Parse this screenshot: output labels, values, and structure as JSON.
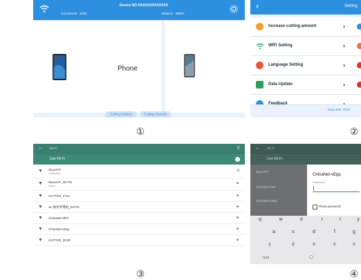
{
  "panel1": {
    "device_label": "Device NO",
    "device_no": "DXXXXXXXXXXXX",
    "cut_amount_label": "Cut amount",
    "cut_amount": "3358",
    "balance_label": "Balance",
    "balance": "89087",
    "category_label": "Phone",
    "btn_history": "Cutting history",
    "btn_favorite": "Cutting favorite"
  },
  "panel2": {
    "title": "Setting",
    "items": [
      {
        "label": "Increase cutting amount",
        "icon_color": "#f0a030",
        "dot_color": "#2d8fe0"
      },
      {
        "label": "WIFI Setting",
        "icon_color": "#2fae7c",
        "dot_color": "#f07040"
      },
      {
        "label": "Language Setting",
        "icon_color": "#e8583a",
        "dot_color": "#e03030"
      },
      {
        "label": "Data Update",
        "icon_color": "#2f9a5a",
        "dot_color": "#e03030"
      },
      {
        "label": "Feedback",
        "icon_color": "#2d8fe0",
        "dot_color": "#2d8fe0"
      }
    ],
    "data_date_label": "Data date",
    "data_date": "2023"
  },
  "panel3": {
    "title": "Wi-Fi",
    "use_wifi": "Use Wi-Fi",
    "networks": [
      {
        "name": "skycutYF",
        "status": "Connected"
      },
      {
        "name": "skycutYF_Wi-Fi5",
        "status": "Saved"
      },
      {
        "name": "CUTTER_2712",
        "status": ""
      },
      {
        "name": "3L-商务专用机_Wi-Fi5",
        "status": ""
      },
      {
        "name": "ChinaNet-3hFt",
        "status": ""
      },
      {
        "name": "ChinaNet-vEpp",
        "status": ""
      },
      {
        "name": "CUTTER_3C08",
        "status": ""
      }
    ]
  },
  "panel4": {
    "title": "Wi-Fi",
    "use_wifi": "Use Wi-Fi",
    "networks": [
      "skycutYF",
      "ChinaNet-2Wt",
      "ChinaNet-vEpp"
    ],
    "dialog_title": "ChinaNet-vEpp",
    "password_label": "Password",
    "show_password": "Show password",
    "kb_row1": [
      "q",
      "w",
      "e",
      "r",
      "t",
      "y"
    ],
    "kb_row2": [
      "a",
      "s",
      "d",
      "f",
      "g"
    ],
    "kb_row3": [
      "z",
      "x",
      "c",
      "v"
    ],
    "kb_numkey": "?123"
  },
  "captions": [
    "①",
    "②",
    "③",
    "④"
  ],
  "colors": {
    "accent": "#2d8fe0",
    "teal": "#3a7f6f"
  }
}
